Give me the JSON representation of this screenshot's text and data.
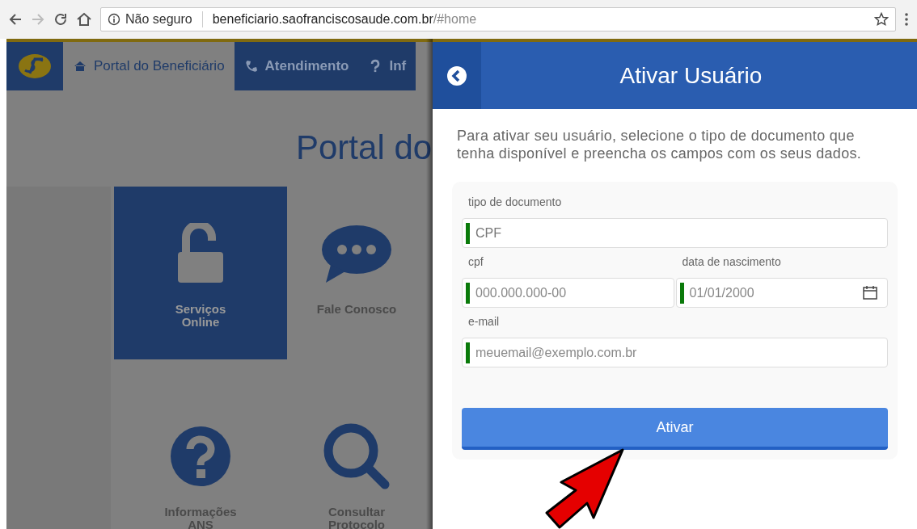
{
  "browser": {
    "security_label": "Não seguro",
    "url_host": "beneficiario.saofranciscosaude.com.br",
    "url_path": "/#home"
  },
  "background_page": {
    "nav": [
      {
        "label": "Portal do Beneficiário",
        "selected": true
      },
      {
        "label": "Atendimento",
        "selected": false
      },
      {
        "label": "Inf",
        "selected": false
      }
    ],
    "heading": "Portal do",
    "tiles": [
      {
        "label": "Serviços Online",
        "selected": true
      },
      {
        "label": "Fale Conosco",
        "selected": false
      },
      {
        "label": "Informações ANS",
        "selected": false
      },
      {
        "label": "Consultar Protocolo",
        "selected": false
      }
    ]
  },
  "panel": {
    "title": "Ativar Usuário",
    "intro": "Para ativar seu usuário, selecione o tipo de documento que tenha disponível e preencha os campos com os seus dados.",
    "field_rows": [
      [
        {
          "label": "tipo de documento",
          "kind": "select",
          "value": "CPF"
        }
      ],
      [
        {
          "label": "cpf",
          "kind": "text",
          "placeholder": "000.000.000-00"
        },
        {
          "label": "data de nascimento",
          "kind": "date",
          "placeholder": "01/01/2000"
        }
      ],
      [
        {
          "label": "e-mail",
          "kind": "text",
          "placeholder": "meuemail@exemplo.com.br"
        }
      ]
    ],
    "button": "Ativar"
  }
}
